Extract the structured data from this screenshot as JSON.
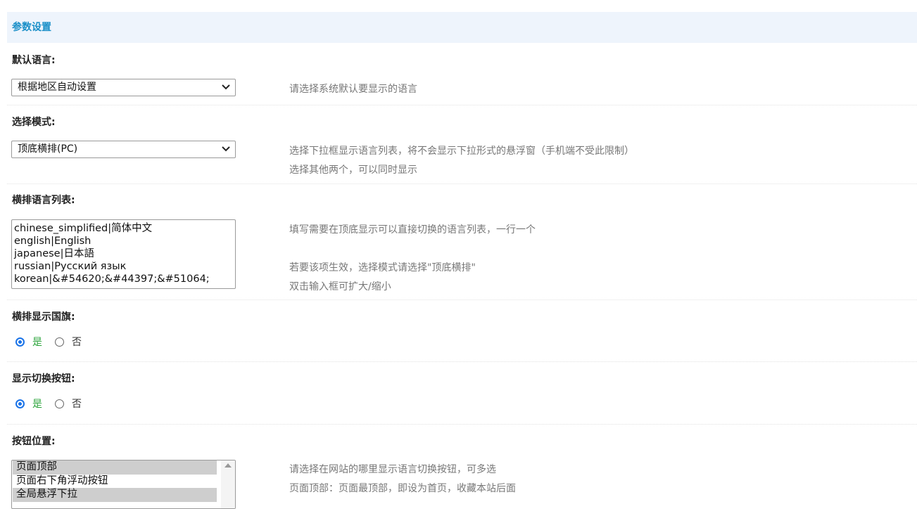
{
  "section": {
    "title": "参数设置"
  },
  "default_language": {
    "label": "默认语言:",
    "selected": "根据地区自动设置",
    "hint": "请选择系统默认要显示的语言"
  },
  "mode": {
    "label": "选择模式:",
    "selected": "顶底横排(PC)",
    "hints": [
      "选择下拉框显示语言列表，将不会显示下拉形式的悬浮窗（手机端不受此限制）",
      "选择其他两个，可以同时显示"
    ]
  },
  "horizontal_list": {
    "label": "横排语言列表:",
    "lines": [
      "chinese_simplified|简体中文",
      "english|English",
      "japanese|日本語",
      "russian|Русский язык",
      "korean|&#54620;&#44397;&#51064;"
    ],
    "hints": [
      "填写需要在顶底显示可以直接切换的语言列表，一行一个",
      "若要该项生效，选择模式请选择\"顶底横排\"",
      "双击输入框可扩大/缩小"
    ]
  },
  "show_flag": {
    "label": "横排显示国旗:",
    "yes": "是",
    "no": "否",
    "value": "yes"
  },
  "show_button": {
    "label": "显示切换按钮:",
    "yes": "是",
    "no": "否",
    "value": "yes"
  },
  "button_position": {
    "label": "按钮位置:",
    "options": [
      {
        "text": "页面顶部",
        "selected": true
      },
      {
        "text": "页面右下角浮动按钮",
        "selected": false
      },
      {
        "text": "全局悬浮下拉",
        "selected": true
      }
    ],
    "hints": [
      "请选择在网站的哪里显示语言切换按钮，可多选",
      "页面顶部：页面最顶部，即设为首页，收藏本站后面"
    ]
  },
  "colors": {
    "header_bg": "#eef4fc",
    "header_text": "#1a8fc8",
    "radio_accent": "#1a73e8",
    "yes_text": "#2aa33a"
  }
}
